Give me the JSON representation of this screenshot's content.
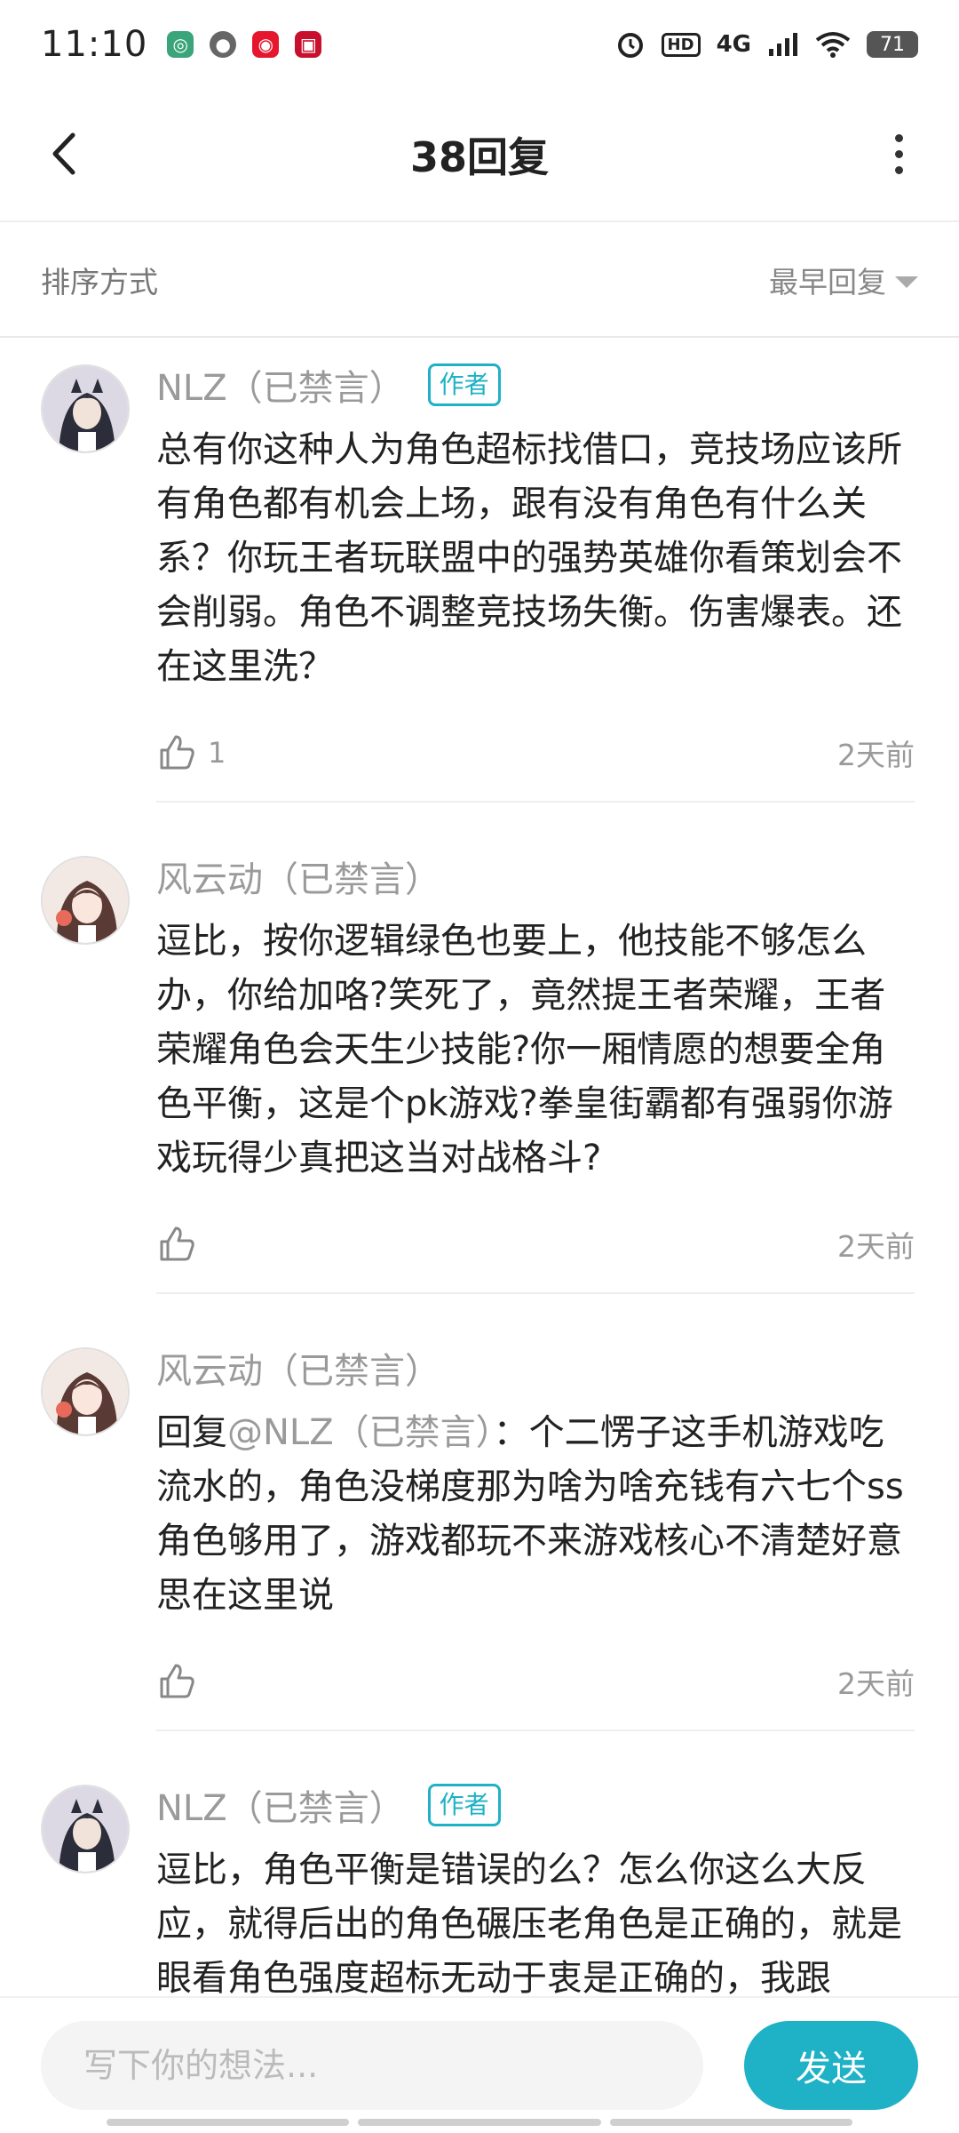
{
  "status_bar": {
    "time": "11:10",
    "network": "4G",
    "hd": "HD",
    "battery": "71"
  },
  "header": {
    "title": "38回复"
  },
  "sort": {
    "label": "排序方式",
    "value": "最早回复"
  },
  "comments": [
    {
      "username": "NLZ（已禁言）",
      "tag": "作者",
      "text": "总有你这种人为角色超标找借口，竞技场应该所有角色都有机会上场，跟有没有角色有什么关系？你玩王者玩联盟中的强势英雄你看策划会不会削弱。角色不调整竞技场失衡。伤害爆表。还在这里洗？",
      "likes": "1",
      "time": "2天前"
    },
    {
      "username": "风云动（已禁言）",
      "text": "逗比，按你逻辑绿色也要上，他技能不够怎么办，你给加咯?笑死了，竟然提王者荣耀，王者荣耀角色会天生少技能?你一厢情愿的想要全角色平衡，这是个pk游戏?拳皇街霸都有强弱你游戏玩得少真把这当对战格斗?",
      "time": "2天前"
    },
    {
      "username": "风云动（已禁言）",
      "reply_prefix": "回复",
      "mention": "@NLZ（已禁言）",
      "reply_colon": "：",
      "text": "个二愣子这手机游戏吃流水的，角色没梯度那为啥为啥充钱有六七个ss角色够用了，游戏都玩不来游戏核心不清楚好意思在这里说",
      "time": "2天前"
    },
    {
      "username": "NLZ（已禁言）",
      "tag": "作者",
      "text": "逗比，角色平衡是错误的么？怎么你这么大反应，就得后出的角色碾压老角色是正确的，就是眼看角色强度超标无动于衷是正确的，我跟"
    }
  ],
  "input": {
    "placeholder": "写下你的想法...",
    "send_label": "发送"
  },
  "colors": {
    "accent": "#1fb1c6"
  }
}
